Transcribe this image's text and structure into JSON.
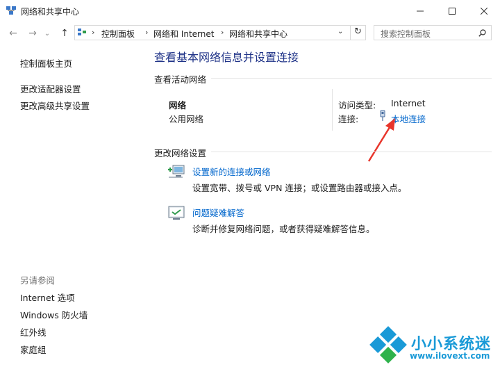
{
  "window": {
    "title": "网络和共享中心"
  },
  "address": {
    "crumbs": [
      "控制面板",
      "网络和 Internet",
      "网络和共享中心"
    ]
  },
  "search": {
    "placeholder": "搜索控制面板"
  },
  "left": {
    "home": "控制面板主页",
    "adapter": "更改适配器设置",
    "advanced": "更改高级共享设置",
    "see_also_title": "另请参阅",
    "see_also": [
      "Internet 选项",
      "Windows 防火墙",
      "红外线",
      "家庭组"
    ]
  },
  "main": {
    "title": "查看基本网络信息并设置连接",
    "active_header": "查看活动网络",
    "network_name": "网络",
    "network_type": "公用网络",
    "access_label": "访问类型:",
    "access_value": "Internet",
    "conn_label": "连接:",
    "conn_value": "本地连接",
    "change_header": "更改网络设置",
    "items": [
      {
        "title": "设置新的连接或网络",
        "desc": "设置宽带、拨号或 VPN 连接；或设置路由器或接入点。"
      },
      {
        "title": "问题疑难解答",
        "desc": "诊断并修复网络问题，或者获得疑难解答信息。"
      }
    ]
  },
  "watermark": {
    "text": "小小系统迷",
    "url": "www.ilovext.com"
  },
  "colors": {
    "link": "#0066cc",
    "title": "#1e3287",
    "arrow": "#e8352b",
    "watermark": "#1a9ad7"
  }
}
